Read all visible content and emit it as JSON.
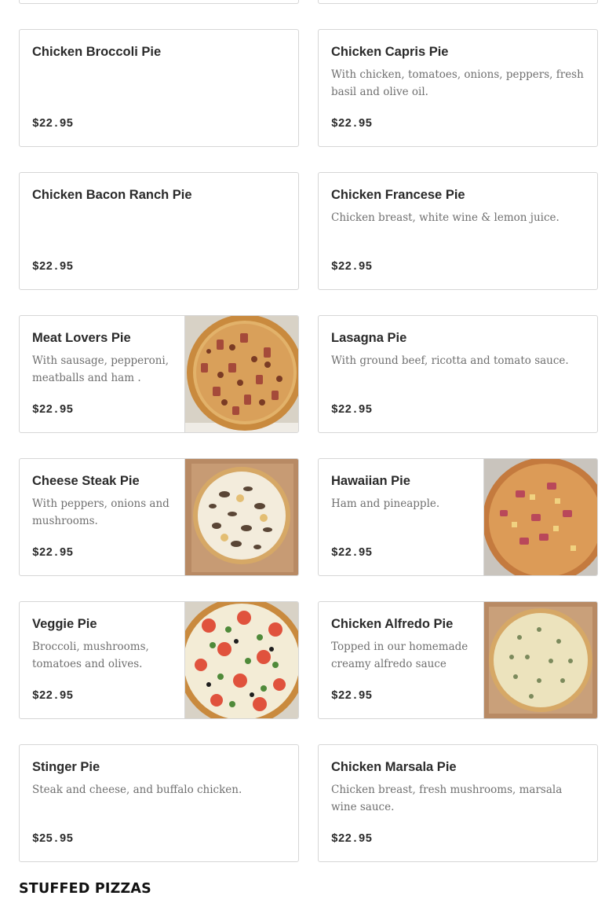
{
  "menu": {
    "section_heading": "STUFFED PIZZAS",
    "items": [
      {
        "name": "Chicken Broccoli Pie",
        "description": "",
        "price": "$22.95"
      },
      {
        "name": "Chicken Capris Pie",
        "description": "With chicken, tomatoes, onions, peppers, fresh basil and olive oil.",
        "price": "$22.95"
      },
      {
        "name": "Chicken Bacon Ranch Pie",
        "description": "",
        "price": "$22.95"
      },
      {
        "name": "Chicken Francese Pie",
        "description": "Chicken breast, white wine & lemon juice.",
        "price": "$22.95"
      },
      {
        "name": "Meat Lovers Pie",
        "description": "With sausage, pepperoni, meatballs and ham .",
        "price": "$22.95",
        "image": "meat-lovers-pizza-photo"
      },
      {
        "name": "Lasagna Pie",
        "description": "With ground beef, ricotta and tomato sauce.",
        "price": "$22.95"
      },
      {
        "name": "Cheese Steak Pie",
        "description": "With peppers, onions and mushrooms.",
        "price": "$22.95",
        "image": "cheese-steak-pizza-photo"
      },
      {
        "name": "Hawaiian Pie",
        "description": "Ham and pineapple.",
        "price": "$22.95",
        "image": "hawaiian-pizza-photo"
      },
      {
        "name": "Veggie Pie",
        "description": "Broccoli, mushrooms, tomatoes and olives.",
        "price": "$22.95",
        "image": "veggie-pizza-photo"
      },
      {
        "name": "Chicken Alfredo Pie",
        "description": "Topped in our homemade creamy alfredo sauce wit...",
        "price": "$22.95",
        "image": "chicken-alfredo-pizza-photo"
      },
      {
        "name": "Stinger Pie",
        "description": "Steak and cheese, and buffalo chicken.",
        "price": "$25.95"
      },
      {
        "name": "Chicken Marsala Pie",
        "description": "Chicken breast, fresh mushrooms, marsala wine sauce.",
        "price": "$22.95"
      }
    ]
  },
  "colors": {
    "border": "#d6d6d6",
    "text": "#2a2a2a",
    "muted": "#6f6f6f"
  }
}
